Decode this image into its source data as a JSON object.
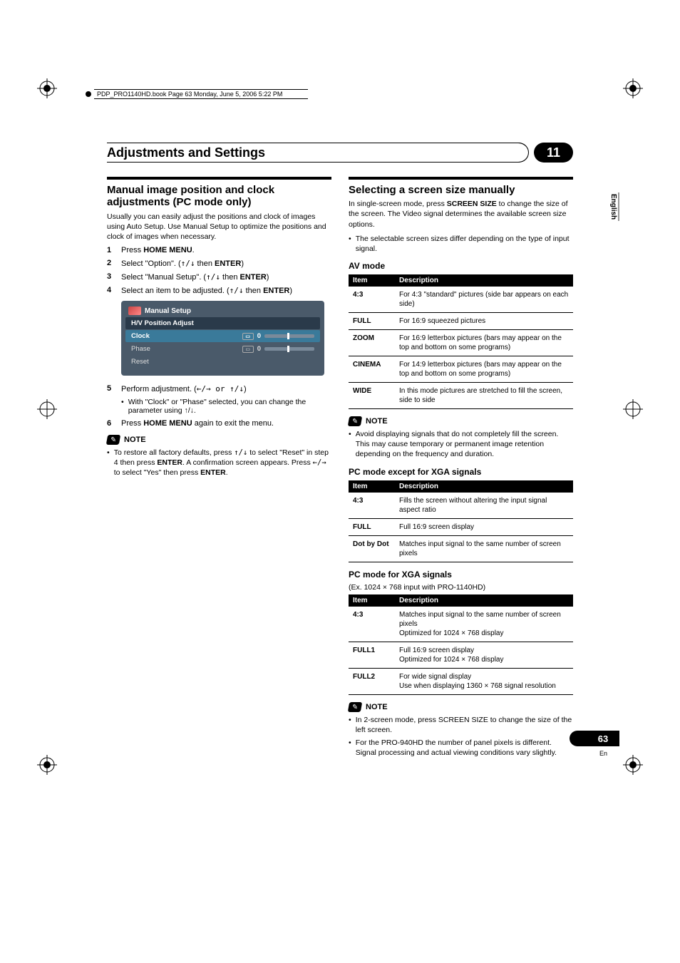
{
  "header": {
    "bookmark": "PDP_PRO1140HD.book  Page 63  Monday, June 5, 2006  5:22 PM"
  },
  "chapter": {
    "title": "Adjustments and Settings",
    "number": "11"
  },
  "langTab": "English",
  "left": {
    "h2": "Manual image position and clock adjustments (PC mode only)",
    "intro": "Usually you can easily adjust the positions and clock of images using Auto Setup. Use Manual Setup to optimize the positions and clock of images when necessary.",
    "steps": {
      "s1": {
        "n": "1",
        "t_pre": "Press ",
        "t_bold": "HOME MENU",
        "t_post": "."
      },
      "s2": {
        "n": "2",
        "t": "Select \"Option\". (",
        "arrows": "↑/↓",
        "t2": " then ",
        "bold": "ENTER",
        "t3": ")"
      },
      "s3": {
        "n": "3",
        "t": "Select \"Manual Setup\". (",
        "arrows": "↑/↓",
        "t2": " then ",
        "bold": "ENTER",
        "t3": ")"
      },
      "s4": {
        "n": "4",
        "t": "Select an item to be adjusted. (",
        "arrows": "↑/↓",
        "t2": " then ",
        "bold": "ENTER",
        "t3": ")"
      },
      "s5": {
        "n": "5",
        "t": "Perform adjustment. (",
        "arrows": "←/→ or ↑/↓",
        "t2": ")"
      },
      "s5sub": "With \"Clock\" or \"Phase\" selected, you can change the parameter using ↑/↓.",
      "s6": {
        "n": "6",
        "t_pre": "Press ",
        "t_bold": "HOME MENU",
        "t_post": " again to exit the menu."
      }
    },
    "menu": {
      "title": "Manual Setup",
      "row_hv": "H/V Position Adjust",
      "row_clock": "Clock",
      "row_clock_val": "0",
      "row_phase": "Phase",
      "row_phase_val": "0",
      "row_reset": "Reset"
    },
    "note": {
      "label": "NOTE",
      "text_pre": "To restore all factory defaults, press ",
      "arrows1": "↑/↓",
      "mid1": " to select \"Reset\" in step 4 then press ",
      "bold1": "ENTER",
      "mid2": ". A confirmation screen appears. Press ",
      "arrows2": "←/→",
      "mid3": " to select \"Yes\" then press ",
      "bold2": "ENTER",
      "end": "."
    }
  },
  "right": {
    "h2": "Selecting a screen size manually",
    "intro_pre": "In single-screen mode, press ",
    "intro_bold": "SCREEN SIZE",
    "intro_post": " to change the size of the screen. The Video signal determines the available screen size options.",
    "bullet1": "The selectable screen sizes differ depending on the type of input signal.",
    "av_mode_h": "AV mode",
    "table_hdr_item": "Item",
    "table_hdr_desc": "Description",
    "av": {
      "r1i": "4:3",
      "r1d": "For 4:3 \"standard\" pictures (side bar appears on each side)",
      "r2i": "FULL",
      "r2d": "For 16:9 squeezed pictures",
      "r3i": "ZOOM",
      "r3d": "For 16:9 letterbox pictures (bars may appear on the top and bottom on some programs)",
      "r4i": "CINEMA",
      "r4d": "For 14:9 letterbox pictures (bars may appear on the top and bottom on some programs)",
      "r5i": "WIDE",
      "r5d": "In this mode pictures are stretched to fill the screen, side to side"
    },
    "note1": {
      "label": "NOTE",
      "text": "Avoid displaying signals that do not completely fill the screen. This may cause temporary or permanent image retention depending on the frequency and duration."
    },
    "pc_h": "PC mode except for XGA signals",
    "pc": {
      "r1i": "4:3",
      "r1d": "Fills the screen without altering the input signal aspect ratio",
      "r2i": "FULL",
      "r2d": "Full 16:9 screen display",
      "r3i": "Dot by Dot",
      "r3d": "Matches input signal to the same number of screen pixels"
    },
    "xga_h": "PC mode for XGA signals",
    "xga_sub": "(Ex. 1024 × 768 input with PRO-1140HD)",
    "xga": {
      "r1i": "4:3",
      "r1d": "Matches input signal to the same number of screen pixels\nOptimized for 1024 × 768 display",
      "r2i": "FULL1",
      "r2d": "Full 16:9 screen display\nOptimized for 1024 × 768 display",
      "r3i": "FULL2",
      "r3d": "For wide signal display\nUse when displaying 1360 × 768 signal resolution"
    },
    "note2": {
      "label": "NOTE",
      "b1": "In 2-screen mode, press SCREEN SIZE to change the size of the left screen.",
      "b2": "For the PRO-940HD the number of panel pixels is different. Signal processing and actual viewing conditions vary slightly."
    }
  },
  "page": {
    "num": "63",
    "lang": "En"
  }
}
